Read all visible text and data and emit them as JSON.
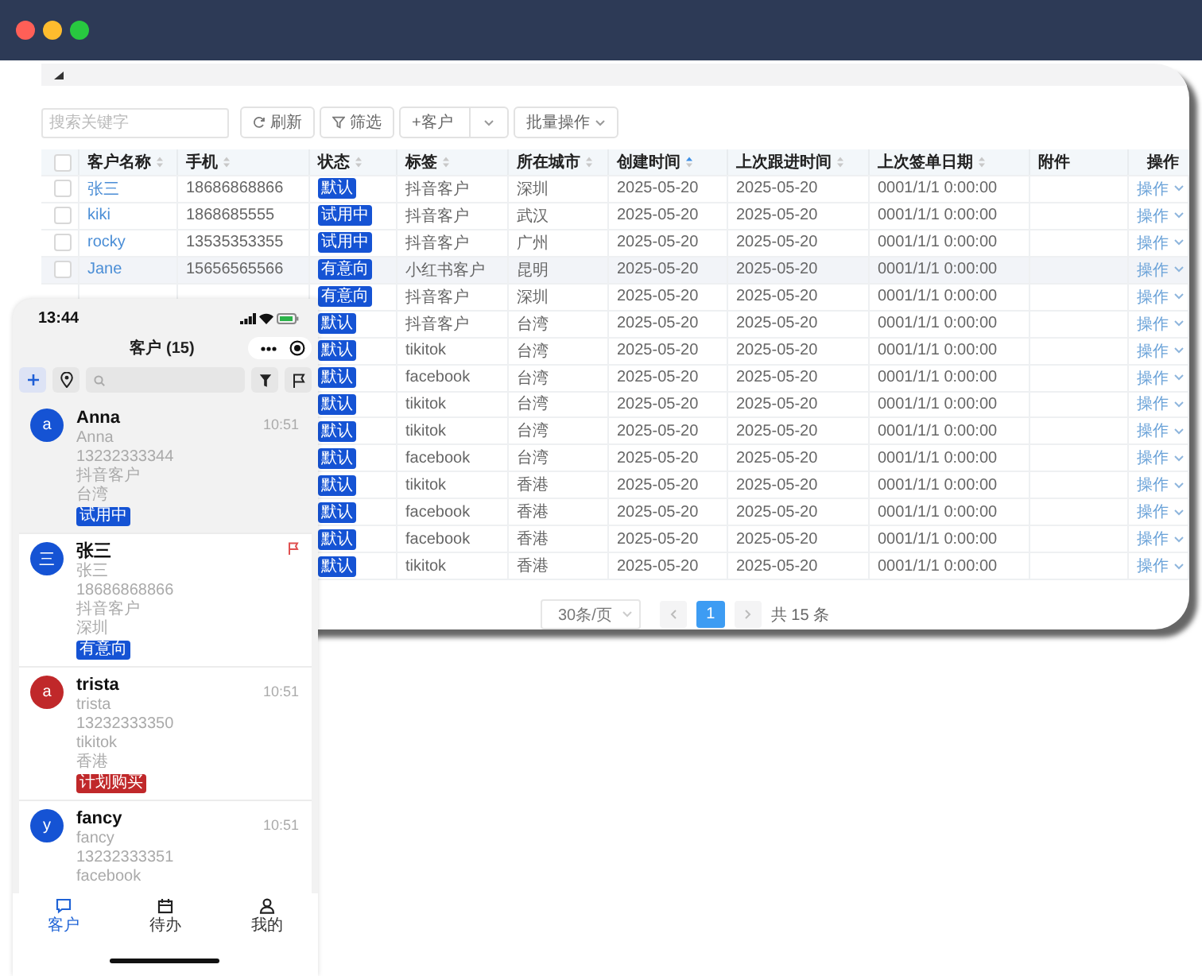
{
  "window": {
    "controls": [
      {
        "color": "#ff5f57"
      },
      {
        "color": "#febc2e"
      },
      {
        "color": "#28c840"
      }
    ]
  },
  "table_panel": {
    "toolbar": {
      "search": {
        "placeholder": "搜索关键字"
      },
      "buttons": [
        {
          "kind": "refresh",
          "label": "刷新"
        },
        {
          "kind": "filter",
          "label": "筛选"
        },
        {
          "kind": "split",
          "label": "+客户"
        },
        {
          "kind": "dropdown",
          "label": "批量操作"
        }
      ]
    },
    "header_checkbox": {
      "checked": false
    },
    "columns": [
      {
        "label": "客户名称",
        "sortable": true,
        "sorted": false
      },
      {
        "label": "手机",
        "sortable": true,
        "sorted": false
      },
      {
        "label": "状态",
        "sortable": true,
        "sorted": false
      },
      {
        "label": "标签",
        "sortable": true,
        "sorted": false
      },
      {
        "label": "所在城市",
        "sortable": true,
        "sorted": false
      },
      {
        "label": "创建时间",
        "sortable": true,
        "sorted": true
      },
      {
        "label": "上次跟进时间",
        "sortable": true,
        "sorted": false
      },
      {
        "label": "上次签单日期",
        "sortable": true,
        "sorted": false
      },
      {
        "label": "附件",
        "sortable": false
      },
      {
        "label": "操作",
        "sortable": false
      }
    ],
    "rows": [
      {
        "checked": false,
        "highlighted": false,
        "name": "张三",
        "phone": "18686868866",
        "status": "默认",
        "tag": "抖音客户",
        "city": "深圳",
        "created": "2025-05-20",
        "followed": "2025-05-20",
        "signed": "0001/1/1 0:00:00",
        "action": "操作"
      },
      {
        "checked": false,
        "highlighted": false,
        "name": "kiki",
        "phone": "1868685555",
        "status": "试用中",
        "tag": "抖音客户",
        "city": "武汉",
        "created": "2025-05-20",
        "followed": "2025-05-20",
        "signed": "0001/1/1 0:00:00",
        "action": "操作"
      },
      {
        "checked": false,
        "highlighted": false,
        "name": "rocky",
        "phone": "13535353355",
        "status": "试用中",
        "tag": "抖音客户",
        "city": "广州",
        "created": "2025-05-20",
        "followed": "2025-05-20",
        "signed": "0001/1/1 0:00:00",
        "action": "操作"
      },
      {
        "checked": false,
        "highlighted": true,
        "name": "Jane",
        "phone": "15656565566",
        "status": "有意向",
        "tag": "小红书客户",
        "city": "昆明",
        "created": "2025-05-20",
        "followed": "2025-05-20",
        "signed": "0001/1/1 0:00:00",
        "action": "操作"
      },
      {
        "highlighted": false,
        "status": "有意向",
        "tag": "抖音客户",
        "city": "深圳",
        "created": "2025-05-20",
        "followed": "2025-05-20",
        "signed": "0001/1/1 0:00:00",
        "action": "操作"
      },
      {
        "highlighted": false,
        "status": "默认",
        "tag": "抖音客户",
        "city": "台湾",
        "created": "2025-05-20",
        "followed": "2025-05-20",
        "signed": "0001/1/1 0:00:00",
        "action": "操作"
      },
      {
        "highlighted": false,
        "status": "默认",
        "tag": "tikitok",
        "city": "台湾",
        "created": "2025-05-20",
        "followed": "2025-05-20",
        "signed": "0001/1/1 0:00:00",
        "action": "操作"
      },
      {
        "highlighted": false,
        "status": "默认",
        "tag": "facebook",
        "city": "台湾",
        "created": "2025-05-20",
        "followed": "2025-05-20",
        "signed": "0001/1/1 0:00:00",
        "action": "操作"
      },
      {
        "highlighted": false,
        "status": "默认",
        "tag": "tikitok",
        "city": "台湾",
        "created": "2025-05-20",
        "followed": "2025-05-20",
        "signed": "0001/1/1 0:00:00",
        "action": "操作"
      },
      {
        "highlighted": false,
        "status": "默认",
        "tag": "tikitok",
        "city": "台湾",
        "created": "2025-05-20",
        "followed": "2025-05-20",
        "signed": "0001/1/1 0:00:00",
        "action": "操作"
      },
      {
        "highlighted": false,
        "status": "默认",
        "tag": "facebook",
        "city": "台湾",
        "created": "2025-05-20",
        "followed": "2025-05-20",
        "signed": "0001/1/1 0:00:00",
        "action": "操作"
      },
      {
        "highlighted": false,
        "status": "默认",
        "tag": "tikitok",
        "city": "香港",
        "created": "2025-05-20",
        "followed": "2025-05-20",
        "signed": "0001/1/1 0:00:00",
        "action": "操作"
      },
      {
        "highlighted": false,
        "status": "默认",
        "tag": "facebook",
        "city": "香港",
        "created": "2025-05-20",
        "followed": "2025-05-20",
        "signed": "0001/1/1 0:00:00",
        "action": "操作"
      },
      {
        "highlighted": false,
        "status": "默认",
        "tag": "facebook",
        "city": "香港",
        "created": "2025-05-20",
        "followed": "2025-05-20",
        "signed": "0001/1/1 0:00:00",
        "action": "操作"
      },
      {
        "highlighted": false,
        "status": "默认",
        "tag": "tikitok",
        "city": "香港",
        "created": "2025-05-20",
        "followed": "2025-05-20",
        "signed": "0001/1/1 0:00:00",
        "action": "操作"
      }
    ],
    "pagination": {
      "page_size": "30条/页",
      "pages": [
        {
          "label": "1",
          "selected": true
        }
      ],
      "total": "共 15 条"
    }
  },
  "phone": {
    "time": "13:44",
    "title": "客户 (15)",
    "contacts": [
      {
        "avatar": "a",
        "color": "#1553d4",
        "name": "Anna",
        "time": "10:51",
        "flagged": false,
        "selected": true,
        "lines": [
          "Anna",
          "13232333344",
          "抖音客户",
          "台湾"
        ],
        "tag": {
          "label": "试用中",
          "color": "#1553d4"
        }
      },
      {
        "avatar": "三",
        "color": "#1553d4",
        "name": "张三",
        "flagged": true,
        "selected": false,
        "lines": [
          "张三",
          "18686868866",
          "抖音客户",
          "深圳"
        ],
        "tag": {
          "label": "有意向",
          "color": "#1553d4"
        }
      },
      {
        "avatar": "a",
        "color": "#c0282a",
        "name": "trista",
        "time": "10:51",
        "flagged": false,
        "selected": false,
        "lines": [
          "trista",
          "13232333350",
          "tikitok",
          "香港"
        ],
        "tag": {
          "label": "计划购买",
          "color": "#c0282a"
        }
      },
      {
        "avatar": "y",
        "color": "#1553d4",
        "name": "fancy",
        "time": "10:51",
        "flagged": false,
        "selected": false,
        "lines": [
          "fancy",
          "13232333351",
          "facebook"
        ]
      }
    ],
    "tabs": [
      {
        "kind": "chat",
        "label": "客户",
        "selected": true
      },
      {
        "kind": "calendar",
        "label": "待办",
        "selected": false
      },
      {
        "kind": "person",
        "label": "我的",
        "selected": false
      }
    ]
  }
}
